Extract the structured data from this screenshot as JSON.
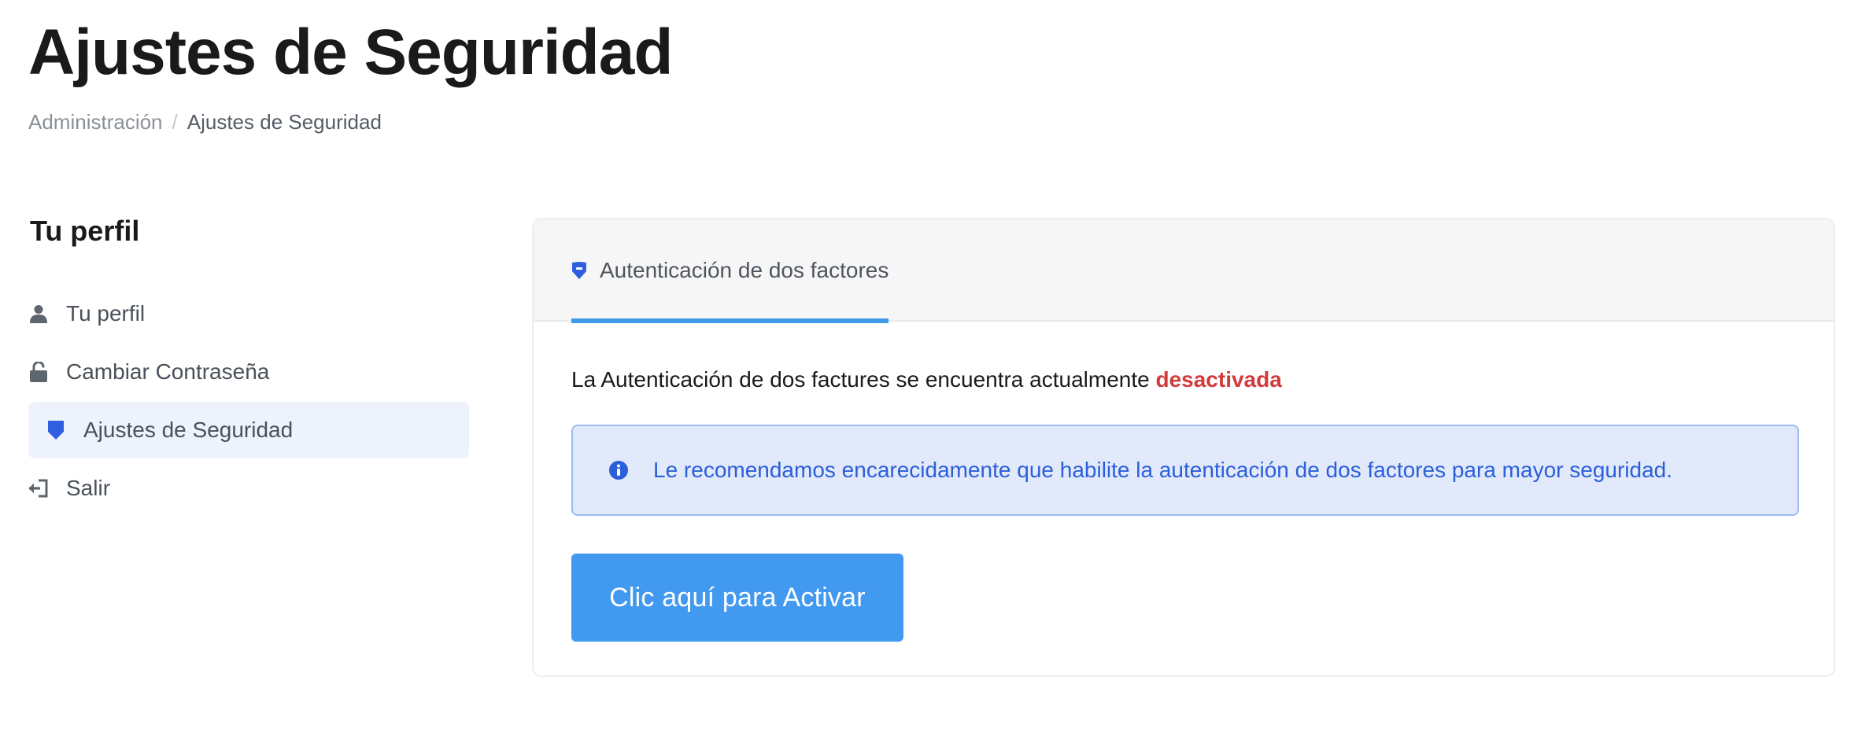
{
  "header": {
    "title": "Ajustes de Seguridad",
    "breadcrumb": {
      "parent": "Administración",
      "separator": "/",
      "current": "Ajustes de Seguridad"
    }
  },
  "sidebar": {
    "title": "Tu perfil",
    "items": [
      {
        "label": "Tu perfil",
        "icon": "user-icon",
        "active": false
      },
      {
        "label": "Cambiar Contraseña",
        "icon": "unlock-icon",
        "active": false
      },
      {
        "label": "Ajustes de Seguridad",
        "icon": "shield-icon",
        "active": true
      },
      {
        "label": "Salir",
        "icon": "sign-out-icon",
        "active": false
      }
    ]
  },
  "card": {
    "tab": {
      "label": "Autenticación de dos factores",
      "icon": "shield-icon"
    },
    "status": {
      "prefix": "La Autenticación de dos factures se encuentra actualmente",
      "value": "desactivada"
    },
    "alert": {
      "icon": "info-icon",
      "text": "Le recomendamos encarecidamente que habilite la autenticación de dos factores para mayor seguridad."
    },
    "activate_button": "Clic aquí para Activar"
  },
  "colors": {
    "accent": "#4299f0",
    "tab_underline": "#4299e8",
    "danger": "#d33a3a",
    "alert_bg": "#e1e9fb",
    "alert_text": "#2b5fd9",
    "active_nav_bg": "#eef2fb",
    "icon_blue": "#2f5fe0"
  }
}
